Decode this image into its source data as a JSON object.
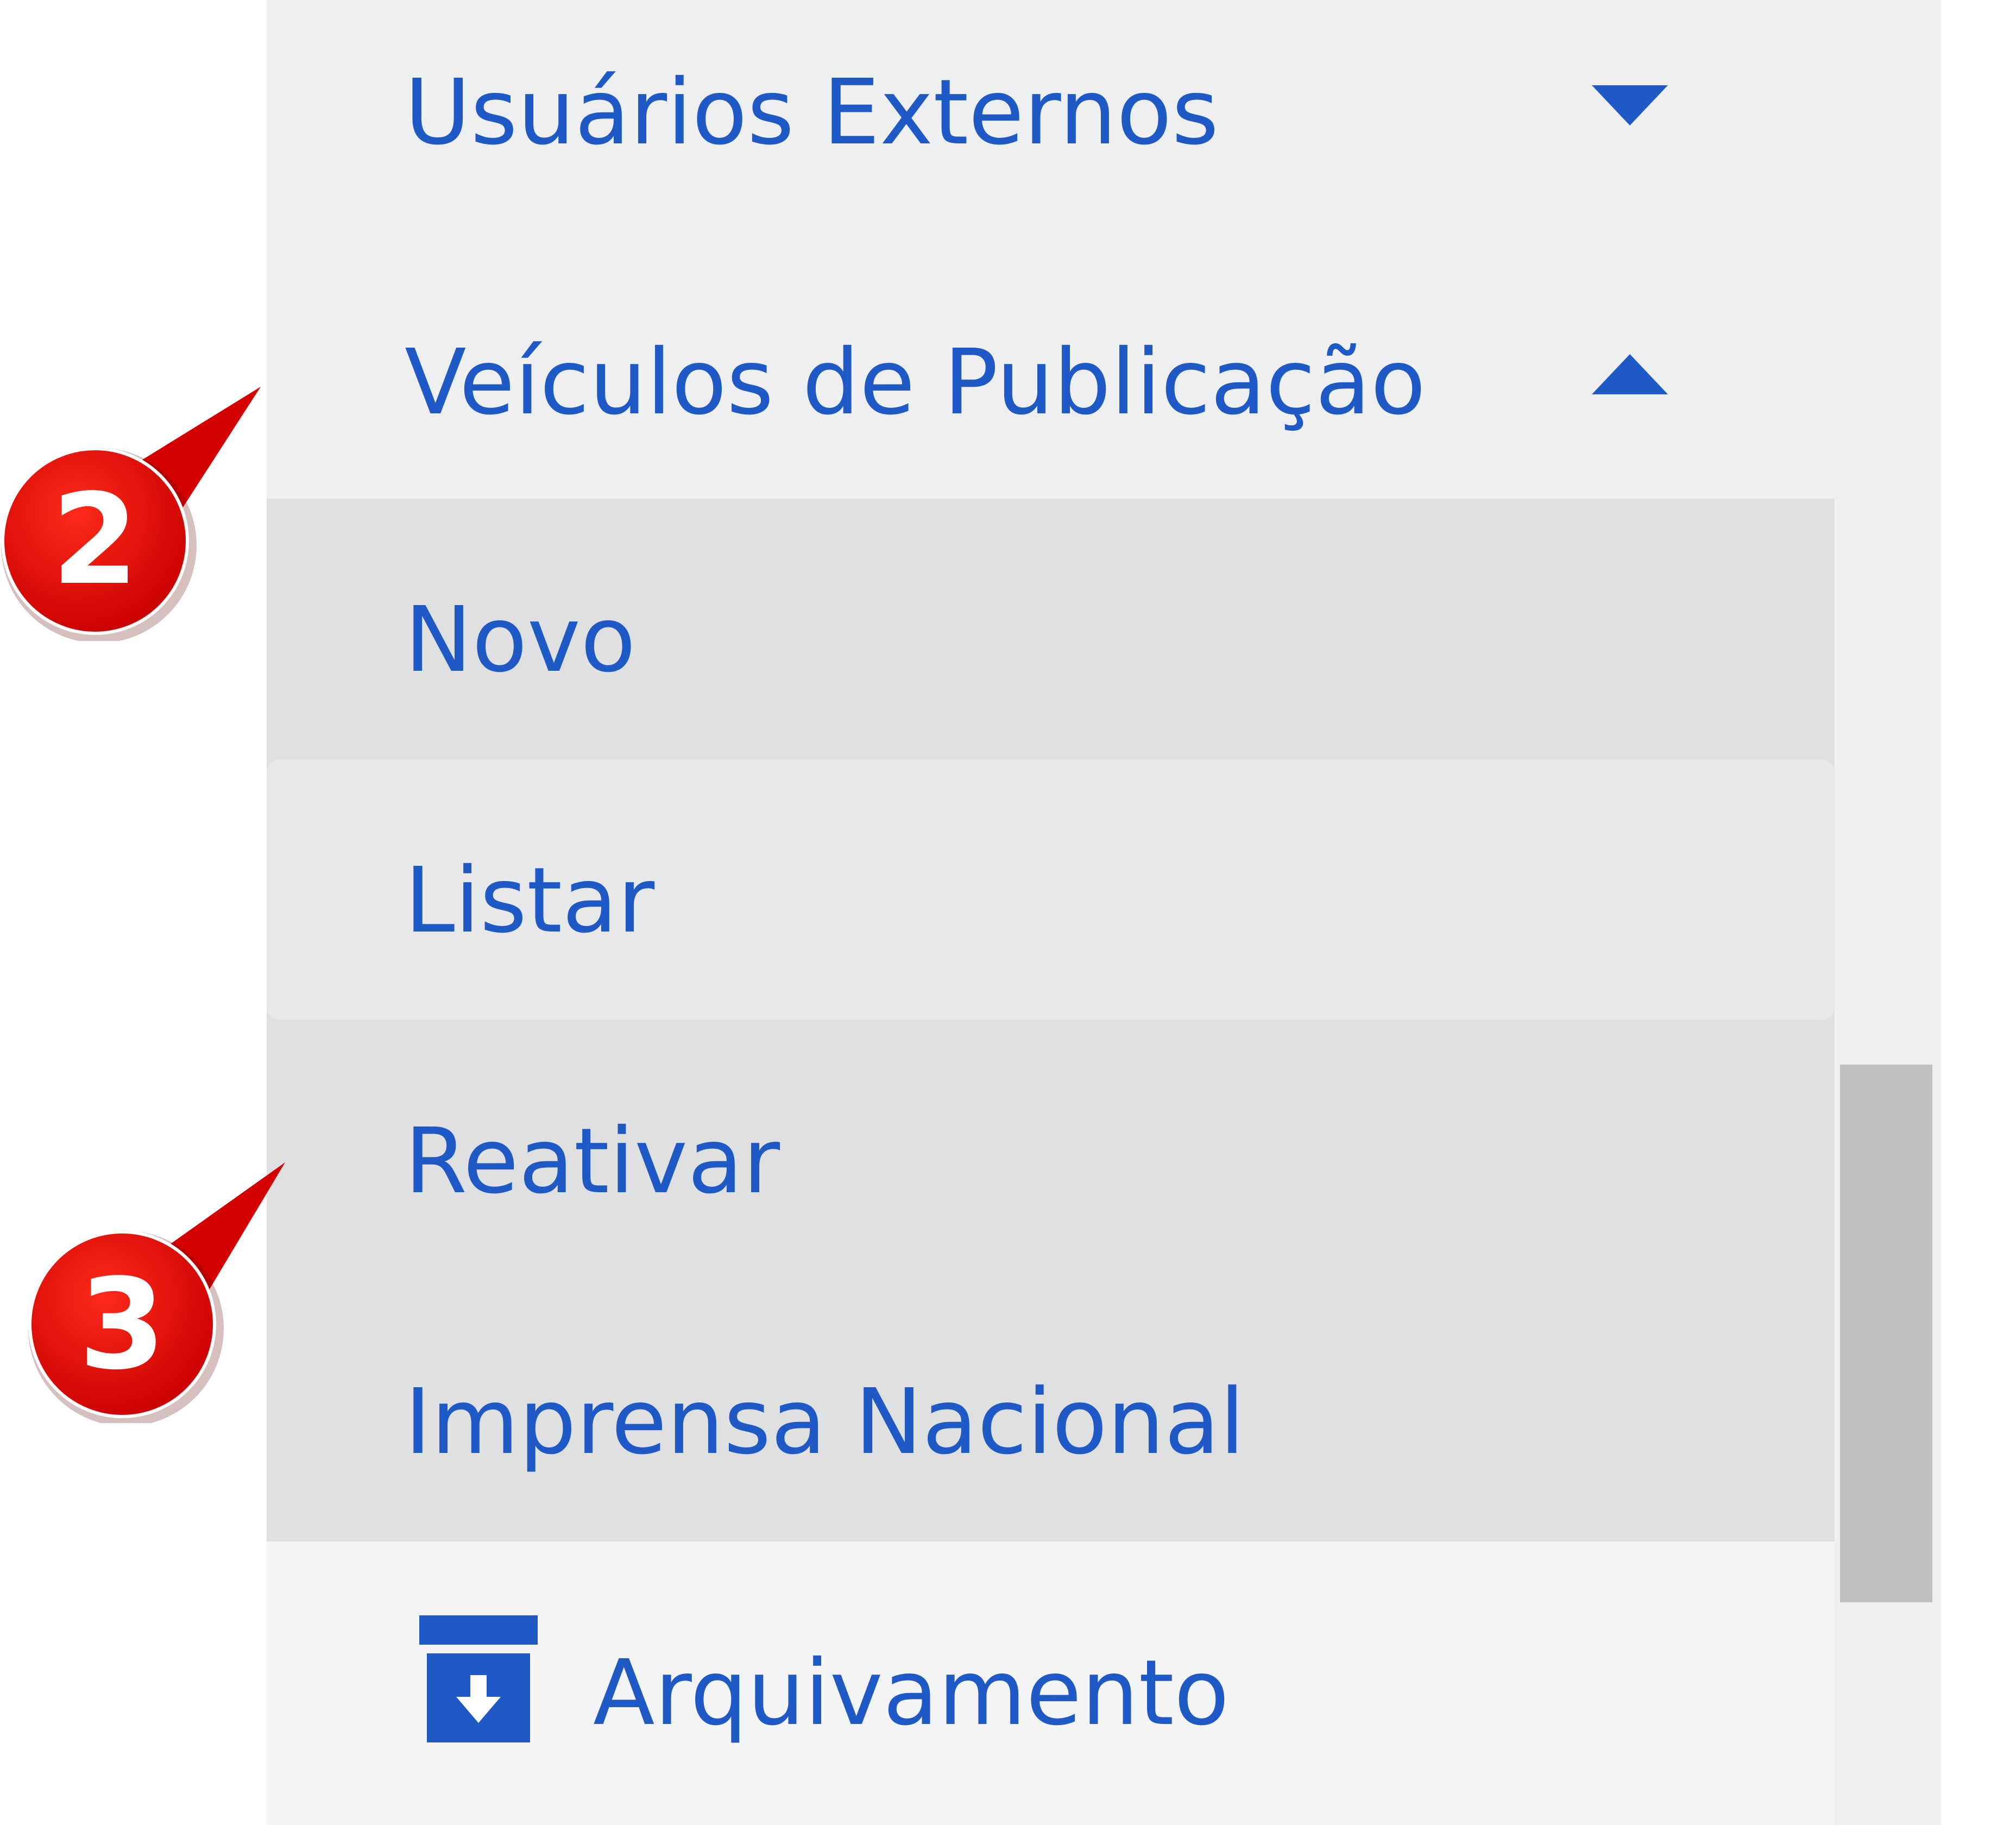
{
  "menu": {
    "usuarios_externos": {
      "label": "Usuários Externos",
      "caret_icon": "caret-down-icon"
    },
    "veiculos_publicacao": {
      "label": "Veículos de Publicação",
      "caret_icon": "caret-up-icon",
      "expanded": true,
      "submenu": [
        {
          "label": "Novo"
        },
        {
          "label": "Listar",
          "selected": true
        },
        {
          "label": "Reativar"
        },
        {
          "label": "Imprensa Nacional"
        }
      ]
    },
    "arquivamento": {
      "label": "Arquivamento",
      "icon": "archive-icon"
    }
  },
  "callouts": [
    {
      "number": "2"
    },
    {
      "number": "3"
    }
  ],
  "colors": {
    "menu_text": "#1e59c6",
    "sidebar_bg": "#eeeff1",
    "submenu_bg": "#dfe0e2",
    "selected_bg": "#e7e8ea",
    "callout_red": "#e30000",
    "scroll_thumb": "#c0c0c0"
  }
}
